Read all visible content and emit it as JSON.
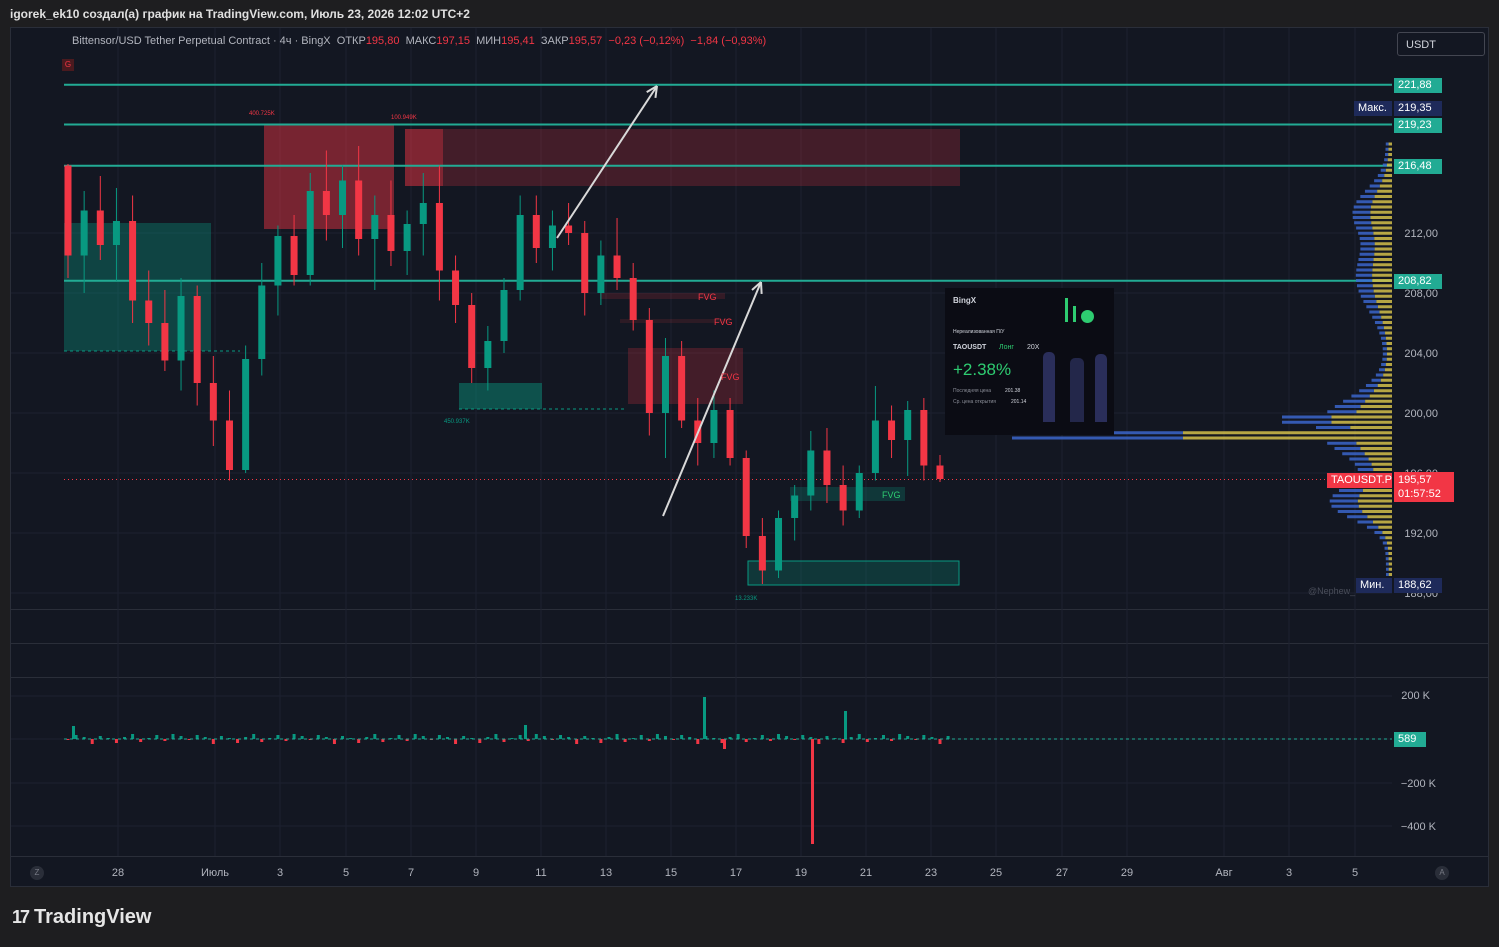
{
  "header": {
    "attribution": "igorek_ek10 создал(а) график на TradingView.com, Июль 23, 2026 12:02 UTC+2"
  },
  "legend": {
    "symbol": "Bittensor/USD Tether Perpetual Contract · 4ч · BingX",
    "open_label": "ОТКР",
    "open_value": "195,80",
    "high_label": "МАКС",
    "high_value": "197,15",
    "low_label": "МИН",
    "low_value": "195,41",
    "close_label": "ЗАКР",
    "close_value": "195,57",
    "change": "−0,23 (−0,12%)",
    "change2": "−1,84 (−0,93%)"
  },
  "currency_button": "USDT",
  "g_badge": "G",
  "price_axis": {
    "ticks": [
      "212,00",
      "208,00",
      "204,00",
      "200,00",
      "196,00",
      "192,00",
      "188,00"
    ],
    "level_tags": [
      {
        "label": "221,88",
        "value": 221.88
      },
      {
        "label": "219,23",
        "value": 219.23
      },
      {
        "label": "216,48",
        "value": 216.48
      },
      {
        "label": "208,82",
        "value": 208.82
      }
    ],
    "max_tag": {
      "name": "Макс.",
      "value": "219,35"
    },
    "min_tag": {
      "name": "Мин.",
      "value": "188,62"
    },
    "current": {
      "symbol": "TAOUSDT.P",
      "price": "195,57",
      "countdown": "01:57:52"
    }
  },
  "date_axis": [
    "28",
    "Июль",
    "3",
    "5",
    "7",
    "9",
    "11",
    "13",
    "15",
    "17",
    "19",
    "21",
    "23",
    "25",
    "27",
    "29",
    "Авг",
    "3",
    "5"
  ],
  "volume_axis": {
    "ticks": [
      "200 K",
      "−200 K",
      "−400 K"
    ],
    "current": "589"
  },
  "annotations": {
    "zone_labels": [
      "400.725K",
      "100.949K",
      "450.937K",
      "13.233K"
    ],
    "fvg": [
      "FVG",
      "FVG",
      "FVG",
      "FVG"
    ],
    "watermark": "@Nephew_"
  },
  "promo_card": {
    "brand": "BingX",
    "subtitle": "Нереализованная П/У",
    "pair": "TAOUSDT",
    "side": "Лонг",
    "leverage": "20X",
    "pnl": "+2.38%",
    "last_price_label": "Последняя цена",
    "last_price": "201.38",
    "entry_label": "Ср. цена открытия",
    "entry_price": "201.14"
  },
  "corner_buttons": {
    "left": "Z",
    "right": "A"
  },
  "footer_brand": "TradingView",
  "colors": {
    "up": "#089981",
    "down": "#f23645",
    "level": "#22ab94",
    "bg": "#131722"
  },
  "chart_data": {
    "type": "candlestick",
    "title": "Bittensor/USD Tether Perpetual Contract · 4ч · BingX",
    "ylim": [
      186.5,
      223.5
    ],
    "x_range": [
      "Jun 26",
      "Aug 6"
    ],
    "levels": [
      221.88,
      219.23,
      216.48,
      208.82
    ],
    "current_price": 195.57,
    "session_high": 219.35,
    "session_low": 188.62,
    "candles": [
      {
        "date": "06-26",
        "o": 216.5,
        "h": 216.6,
        "l": 209.0,
        "c": 210.5
      },
      {
        "date": "06-26b",
        "o": 210.5,
        "h": 214.8,
        "l": 208.0,
        "c": 213.5
      },
      {
        "date": "06-27",
        "o": 213.5,
        "h": 215.8,
        "l": 210.2,
        "c": 211.2
      },
      {
        "date": "06-27b",
        "o": 211.2,
        "h": 215.0,
        "l": 208.8,
        "c": 212.8
      },
      {
        "date": "06-28",
        "o": 212.8,
        "h": 214.5,
        "l": 206.0,
        "c": 207.5
      },
      {
        "date": "06-28b",
        "o": 207.5,
        "h": 209.5,
        "l": 204.5,
        "c": 206.0
      },
      {
        "date": "06-29",
        "o": 206.0,
        "h": 208.2,
        "l": 202.8,
        "c": 203.5
      },
      {
        "date": "06-29b",
        "o": 203.5,
        "h": 209.0,
        "l": 201.5,
        "c": 207.8
      },
      {
        "date": "06-30",
        "o": 207.8,
        "h": 208.5,
        "l": 200.5,
        "c": 202.0
      },
      {
        "date": "06-30b",
        "o": 202.0,
        "h": 203.8,
        "l": 197.8,
        "c": 199.5
      },
      {
        "date": "07-01",
        "o": 199.5,
        "h": 201.5,
        "l": 195.5,
        "c": 196.2
      },
      {
        "date": "07-01b",
        "o": 196.2,
        "h": 204.5,
        "l": 196.0,
        "c": 203.6
      },
      {
        "date": "07-02",
        "o": 203.6,
        "h": 210.0,
        "l": 202.5,
        "c": 208.5
      },
      {
        "date": "07-02b",
        "o": 208.5,
        "h": 212.5,
        "l": 206.5,
        "c": 211.8
      },
      {
        "date": "07-03",
        "o": 211.8,
        "h": 213.2,
        "l": 208.5,
        "c": 209.2
      },
      {
        "date": "07-03b",
        "o": 209.2,
        "h": 216.0,
        "l": 208.5,
        "c": 214.8
      },
      {
        "date": "07-04",
        "o": 214.8,
        "h": 217.5,
        "l": 211.5,
        "c": 213.2
      },
      {
        "date": "07-04b",
        "o": 213.2,
        "h": 216.5,
        "l": 211.0,
        "c": 215.5
      },
      {
        "date": "07-05",
        "o": 215.5,
        "h": 217.8,
        "l": 210.5,
        "c": 211.6
      },
      {
        "date": "07-05b",
        "o": 211.6,
        "h": 214.5,
        "l": 208.2,
        "c": 213.2
      },
      {
        "date": "07-06",
        "o": 213.2,
        "h": 215.5,
        "l": 209.8,
        "c": 210.8
      },
      {
        "date": "07-06b",
        "o": 210.8,
        "h": 213.5,
        "l": 209.2,
        "c": 212.6
      },
      {
        "date": "07-07",
        "o": 212.6,
        "h": 216.0,
        "l": 210.5,
        "c": 214.0
      },
      {
        "date": "07-07b",
        "o": 214.0,
        "h": 216.5,
        "l": 207.5,
        "c": 209.5
      },
      {
        "date": "07-08",
        "o": 209.5,
        "h": 210.5,
        "l": 206.0,
        "c": 207.2
      },
      {
        "date": "07-08b",
        "o": 207.2,
        "h": 208.0,
        "l": 202.0,
        "c": 203.0
      },
      {
        "date": "07-09",
        "o": 203.0,
        "h": 205.8,
        "l": 201.5,
        "c": 204.8
      },
      {
        "date": "07-09b",
        "o": 204.8,
        "h": 209.0,
        "l": 204.0,
        "c": 208.2
      },
      {
        "date": "07-10",
        "o": 208.2,
        "h": 214.5,
        "l": 207.5,
        "c": 213.2
      },
      {
        "date": "07-10b",
        "o": 213.2,
        "h": 214.5,
        "l": 210.0,
        "c": 211.0
      },
      {
        "date": "07-11",
        "o": 211.0,
        "h": 213.5,
        "l": 209.5,
        "c": 212.5
      },
      {
        "date": "07-11b",
        "o": 212.5,
        "h": 214.0,
        "l": 211.2,
        "c": 212.0
      },
      {
        "date": "07-12",
        "o": 212.0,
        "h": 212.8,
        "l": 206.5,
        "c": 208.0
      },
      {
        "date": "07-12b",
        "o": 208.0,
        "h": 211.5,
        "l": 207.2,
        "c": 210.5
      },
      {
        "date": "07-13",
        "o": 210.5,
        "h": 213.0,
        "l": 208.2,
        "c": 209.0
      },
      {
        "date": "07-13b",
        "o": 209.0,
        "h": 210.0,
        "l": 205.5,
        "c": 206.2
      },
      {
        "date": "07-14",
        "o": 206.2,
        "h": 207.0,
        "l": 198.5,
        "c": 200.0
      },
      {
        "date": "07-14b",
        "o": 200.0,
        "h": 205.0,
        "l": 197.0,
        "c": 203.8
      },
      {
        "date": "07-15",
        "o": 203.8,
        "h": 204.8,
        "l": 199.0,
        "c": 199.5
      },
      {
        "date": "07-15b",
        "o": 199.5,
        "h": 201.0,
        "l": 196.5,
        "c": 198.0
      },
      {
        "date": "07-16",
        "o": 198.0,
        "h": 201.5,
        "l": 197.0,
        "c": 200.2
      },
      {
        "date": "07-16b",
        "o": 200.2,
        "h": 201.0,
        "l": 196.5,
        "c": 197.0
      },
      {
        "date": "07-17",
        "o": 197.0,
        "h": 197.5,
        "l": 191.0,
        "c": 191.8
      },
      {
        "date": "07-17b",
        "o": 191.8,
        "h": 193.0,
        "l": 188.6,
        "c": 189.5
      },
      {
        "date": "07-18",
        "o": 189.5,
        "h": 193.5,
        "l": 189.0,
        "c": 193.0
      },
      {
        "date": "07-18b",
        "o": 193.0,
        "h": 195.2,
        "l": 191.5,
        "c": 194.5
      },
      {
        "date": "07-19",
        "o": 194.5,
        "h": 198.8,
        "l": 193.5,
        "c": 197.5
      },
      {
        "date": "07-19b",
        "o": 197.5,
        "h": 199.0,
        "l": 194.0,
        "c": 195.2
      },
      {
        "date": "07-20",
        "o": 195.2,
        "h": 196.5,
        "l": 192.5,
        "c": 193.5
      },
      {
        "date": "07-20b",
        "o": 193.5,
        "h": 196.5,
        "l": 193.0,
        "c": 196.0
      },
      {
        "date": "07-21",
        "o": 196.0,
        "h": 201.8,
        "l": 195.5,
        "c": 199.5
      },
      {
        "date": "07-21b",
        "o": 199.5,
        "h": 200.5,
        "l": 197.0,
        "c": 198.2
      },
      {
        "date": "07-22",
        "o": 198.2,
        "h": 200.8,
        "l": 195.8,
        "c": 200.2
      },
      {
        "date": "07-22b",
        "o": 200.2,
        "h": 201.0,
        "l": 195.5,
        "c": 196.5
      },
      {
        "date": "07-23",
        "o": 196.5,
        "h": 197.2,
        "l": 195.4,
        "c": 195.6
      }
    ]
  }
}
